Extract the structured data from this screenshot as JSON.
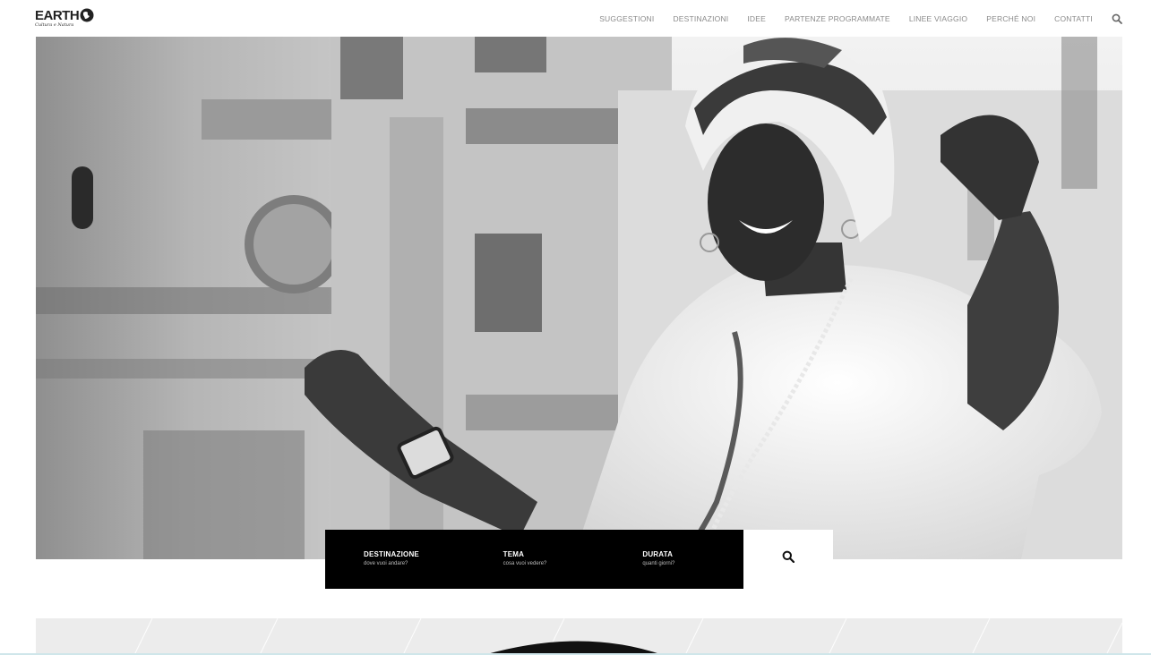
{
  "header": {
    "logo_text": "EARTH",
    "logo_tagline": "Cultura e Natura",
    "nav": [
      {
        "label": "SUGGESTIONI"
      },
      {
        "label": "DESTINAZIONI"
      },
      {
        "label": "IDEE"
      },
      {
        "label": "PARTENZE PROGRAMMATE"
      },
      {
        "label": "LINEE VIAGGIO"
      },
      {
        "label": "PERCHÉ NOI"
      },
      {
        "label": "CONTATTI"
      }
    ],
    "search_icon": "search-icon"
  },
  "search": {
    "fields": [
      {
        "label": "DESTINAZIONE",
        "hint": "dove vuoi andare?"
      },
      {
        "label": "TEMA",
        "hint": "cosa vuoi vedere?"
      },
      {
        "label": "DURATA",
        "hint": "quanti giorni?"
      }
    ],
    "button_icon": "search-icon"
  },
  "colors": {
    "nav_text": "#8a8a8a",
    "search_bar_bg": "#000000",
    "lower_section_bg": "#ececec"
  }
}
